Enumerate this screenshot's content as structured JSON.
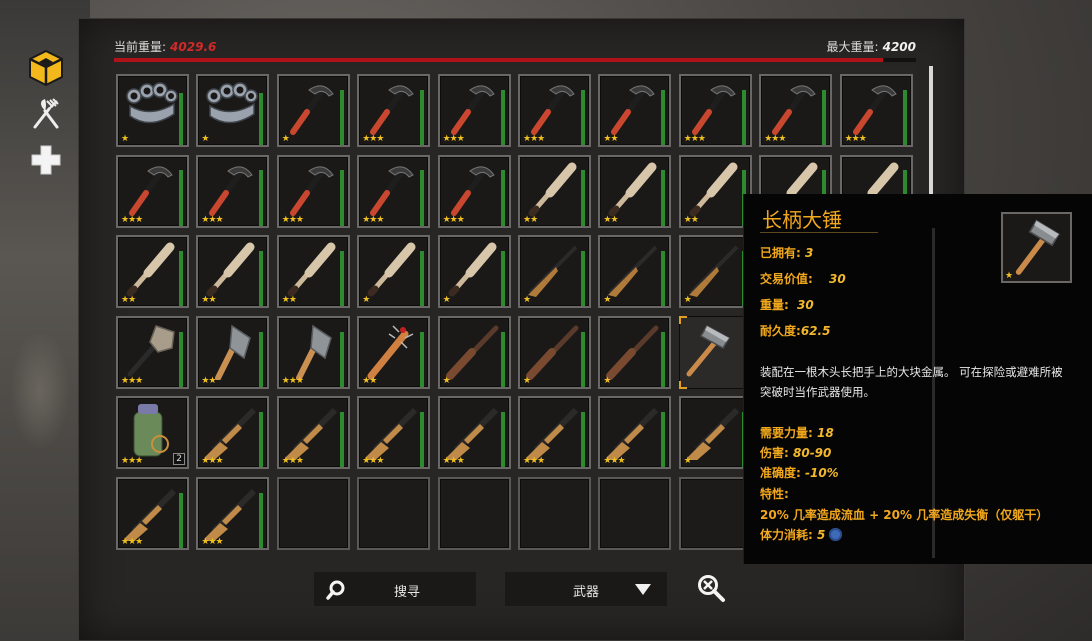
{
  "weight": {
    "current_label": "当前重量:",
    "current_value": "4029.6",
    "max_label": "最大重量:",
    "max_value": "4200",
    "fraction": 0.959
  },
  "side_icons": [
    "inventory-cube-icon",
    "fork-knife-icon",
    "medical-cross-icon"
  ],
  "slots": [
    {
      "item": "knuckles",
      "stars": "★",
      "dura": 0.8
    },
    {
      "item": "knuckles",
      "stars": "★",
      "dura": 0.8
    },
    {
      "item": "pickaxe",
      "stars": "★",
      "dura": 0.85
    },
    {
      "item": "pickaxe",
      "stars": "★★★",
      "dura": 0.85
    },
    {
      "item": "pickaxe",
      "stars": "★★★",
      "dura": 0.85
    },
    {
      "item": "pickaxe",
      "stars": "★★★",
      "dura": 0.85
    },
    {
      "item": "pickaxe",
      "stars": "★★",
      "dura": 0.85
    },
    {
      "item": "pickaxe",
      "stars": "★★★",
      "dura": 0.85
    },
    {
      "item": "pickaxe",
      "stars": "★★★",
      "dura": 0.85
    },
    {
      "item": "pickaxe",
      "stars": "★★★",
      "dura": 0.85
    },
    {
      "item": "pickaxe",
      "stars": "★★★",
      "dura": 0.85
    },
    {
      "item": "pickaxe",
      "stars": "★★★",
      "dura": 0.85
    },
    {
      "item": "pickaxe",
      "stars": "★★★",
      "dura": 0.85
    },
    {
      "item": "pickaxe",
      "stars": "★★★",
      "dura": 0.85
    },
    {
      "item": "pickaxe",
      "stars": "★★★",
      "dura": 0.85
    },
    {
      "item": "bat",
      "stars": "★★",
      "dura": 0.85
    },
    {
      "item": "bat",
      "stars": "★★",
      "dura": 0.85
    },
    {
      "item": "bat",
      "stars": "★★",
      "dura": 0.85
    },
    {
      "item": "bat",
      "stars": "★★",
      "dura": 0.85
    },
    {
      "item": "bat",
      "stars": "★★",
      "dura": 0.85
    },
    {
      "item": "bat",
      "stars": "★★",
      "dura": 0.85
    },
    {
      "item": "bat",
      "stars": "★★",
      "dura": 0.85
    },
    {
      "item": "bat",
      "stars": "★★",
      "dura": 0.85
    },
    {
      "item": "bat",
      "stars": "★",
      "dura": 0.85
    },
    {
      "item": "bat",
      "stars": "★",
      "dura": 0.85
    },
    {
      "item": "rifle",
      "stars": "★",
      "dura": 0.85
    },
    {
      "item": "rifle",
      "stars": "★",
      "dura": 0.85
    },
    {
      "item": "rifle",
      "stars": "★",
      "dura": 0.85
    },
    {
      "item": "rifle",
      "stars": "★",
      "dura": 0.85
    },
    {
      "item": "rifle",
      "stars": "★",
      "dura": 0.85
    },
    {
      "item": "mace",
      "stars": "★★★",
      "dura": 0.85
    },
    {
      "item": "axe",
      "stars": "★★",
      "dura": 0.85
    },
    {
      "item": "axe",
      "stars": "★★★",
      "dura": 0.85
    },
    {
      "item": "spiked-club",
      "stars": "★★",
      "dura": 0.85
    },
    {
      "item": "musket",
      "stars": "★",
      "dura": 0.85
    },
    {
      "item": "musket",
      "stars": "★",
      "dura": 0.85
    },
    {
      "item": "musket",
      "stars": "★",
      "dura": 0.85
    },
    {
      "item": "sledgehammer",
      "stars": "",
      "dura": 0,
      "selected": true
    },
    {
      "item": "musket",
      "stars": "★",
      "dura": 0.85
    },
    {
      "item": "musket",
      "stars": "★",
      "dura": 0.85
    },
    {
      "item": "canister",
      "stars": "★★★",
      "dura": 0,
      "count": "2"
    },
    {
      "item": "shotgun",
      "stars": "★★★",
      "dura": 0.85
    },
    {
      "item": "shotgun",
      "stars": "★★★",
      "dura": 0.85
    },
    {
      "item": "shotgun",
      "stars": "★★★",
      "dura": 0.85
    },
    {
      "item": "shotgun",
      "stars": "★★★",
      "dura": 0.85
    },
    {
      "item": "shotgun",
      "stars": "★★★",
      "dura": 0.85
    },
    {
      "item": "shotgun",
      "stars": "★★★",
      "dura": 0.85
    },
    {
      "item": "shotgun",
      "stars": "★",
      "dura": 0.85
    },
    {
      "item": "shotgun",
      "stars": "★",
      "dura": 0.85
    },
    {
      "item": "shotgun",
      "stars": "★",
      "dura": 0.85
    },
    {
      "item": "shotgun",
      "stars": "★★★",
      "dura": 0.85
    },
    {
      "item": "shotgun",
      "stars": "★★★",
      "dura": 0.85
    },
    {
      "item": "empty"
    },
    {
      "item": "empty"
    },
    {
      "item": "empty"
    },
    {
      "item": "empty"
    },
    {
      "item": "empty"
    },
    {
      "item": "empty"
    },
    {
      "item": "empty"
    },
    {
      "item": "empty"
    }
  ],
  "search": {
    "label": "搜寻"
  },
  "filter": {
    "label": "武器"
  },
  "tooltip": {
    "title": "长柄大锤",
    "owned_label": "已拥有:",
    "owned_value": "3",
    "trade_label": "交易价值:",
    "trade_value": "30",
    "weight_label": "重量:",
    "weight_value": "30",
    "durability_label": "耐久度:",
    "durability_value": "62.5",
    "description": "装配在一根木头长把手上的大块金属。 可在探险或避难所被突破时当作武器使用。",
    "strength_label": "需要力量:",
    "strength_value": "18",
    "damage_label": "伤害:",
    "damage_value": "80-90",
    "accuracy_label": "准确度:",
    "accuracy_value": "-10%",
    "trait_label": "特性:",
    "trait_value": "20% 几率造成流血 + 20% 几率造成失衡（仅躯干）",
    "stamina_label": "体力消耗:",
    "stamina_value": "5",
    "image_stars": "★"
  }
}
